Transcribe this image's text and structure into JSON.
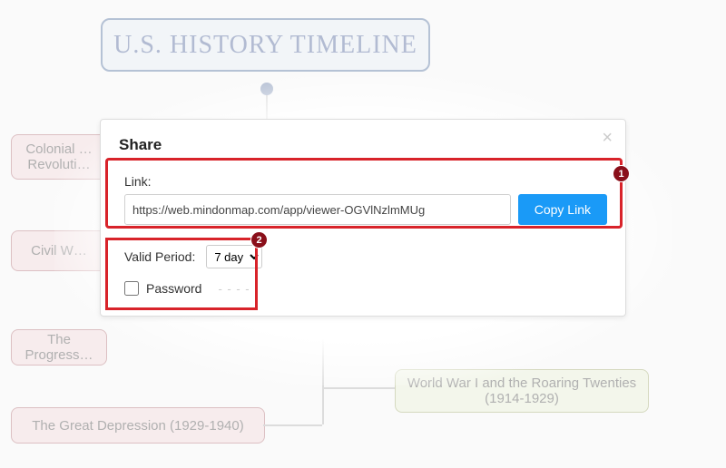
{
  "background": {
    "root_title": "U.S. HISTORY TIMELINE",
    "nodes": {
      "colonial": "Colonial …\nRevoluti…",
      "civil": "Civil W…",
      "progressive": "The Progress…",
      "depression": "The Great Depression (1929-1940)",
      "wwi": "World War I and the Roaring Twenties (1914-1929)"
    }
  },
  "dialog": {
    "title": "Share",
    "close": "×",
    "link_label": "Link:",
    "link_value": "https://web.mindonmap.com/app/viewer-OGVlNzlmMUg",
    "copy_label": "Copy Link",
    "valid_label": "Valid Period:",
    "valid_value": "7 day",
    "password_label": "Password",
    "password_placeholder": "- - - -"
  },
  "annotations": {
    "badge1": "1",
    "badge2": "2"
  }
}
